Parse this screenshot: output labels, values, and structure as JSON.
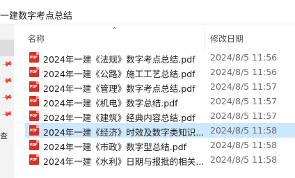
{
  "window": {
    "title": "一建数字考点总结"
  },
  "columns": {
    "name": "名称",
    "date": "修改日期"
  },
  "sidebar": {
    "partial_label": "查"
  },
  "files": [
    {
      "name": "2024年一建《法规》数字考点总结.pdf",
      "date": "2024/8/5 11:56",
      "selected": false
    },
    {
      "name": "2024年一建《公路》施工工艺总结.pdf",
      "date": "2024/8/5 11:56",
      "selected": false
    },
    {
      "name": "2024年一建《管理》数字考点总结.pdf",
      "date": "2024/8/5 11:57",
      "selected": false
    },
    {
      "name": "2024年一建《机电》数字总结.pdf",
      "date": "2024/8/5 11:57",
      "selected": false
    },
    {
      "name": "2024年一建《建筑》经典内容总结.pdf",
      "date": "2024/8/5 11:57",
      "selected": false
    },
    {
      "name": "2024年一建《经济》时效及数字类知识...",
      "date": "2024/8/5 11:58",
      "selected": true
    },
    {
      "name": "2024年一建《市政》数字型总结.pdf",
      "date": "2024/8/5 11:58",
      "selected": false
    },
    {
      "name": "2024年一建《水利》日期与报批的相关...",
      "date": "2024/8/5 11:58",
      "selected": false
    }
  ]
}
